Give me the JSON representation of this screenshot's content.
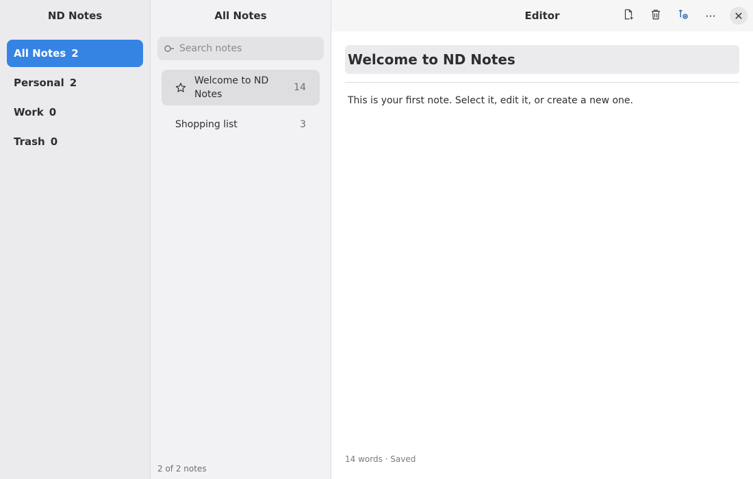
{
  "sidebar": {
    "title": "ND Notes",
    "folders": [
      {
        "label": "All Notes",
        "count": "2",
        "active": true
      },
      {
        "label": "Personal",
        "count": "2"
      },
      {
        "label": "Work",
        "count": "0"
      },
      {
        "label": "Trash",
        "count": "0"
      }
    ]
  },
  "notelist": {
    "title": "All Notes",
    "search_placeholder": "Search notes",
    "notes": [
      {
        "title": "Welcome to ND Notes",
        "count": "14",
        "starred": true,
        "selected": true
      },
      {
        "title": "Shopping list",
        "count": "3"
      }
    ],
    "footer": "2 of 2 notes"
  },
  "editor": {
    "title": "Editor",
    "toolbar": {
      "new_note_icon": "file-plus-icon",
      "delete_icon": "trash-icon",
      "move_icon": "move-to-folder-icon",
      "more_label": "···",
      "close_label": "✕"
    },
    "note_title": "Welcome to ND Notes",
    "body": "This is your first note. Select it, edit it, or create a new one.",
    "status": "14 words · Saved"
  },
  "colors": {
    "accent": "#3584e4"
  }
}
